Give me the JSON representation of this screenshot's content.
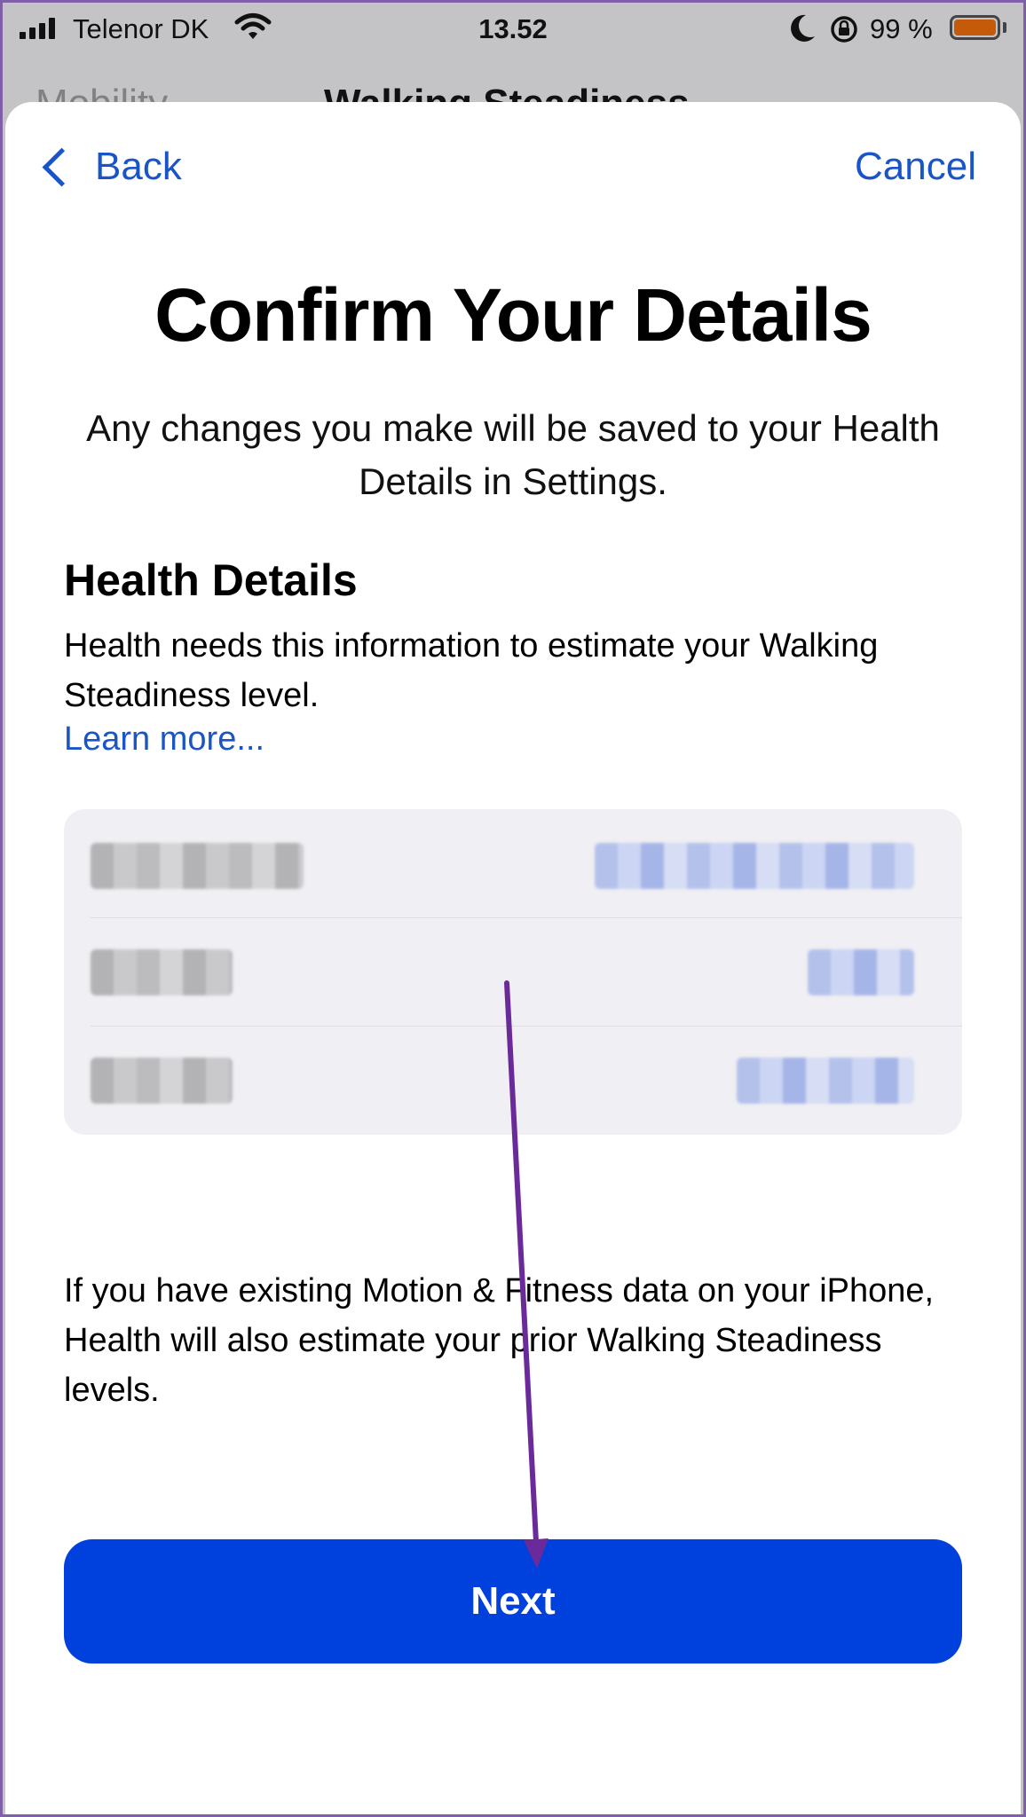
{
  "status_bar": {
    "carrier": "Telenor DK",
    "time": "13.52",
    "battery_percent": "99 %",
    "battery_color": "#c45a0a"
  },
  "behind_nav": {
    "back_label": "Mobility",
    "title": "Walking Steadiness"
  },
  "nav": {
    "back_label": "Back",
    "cancel_label": "Cancel"
  },
  "title": "Confirm Your Details",
  "subtitle": "Any changes you make will be saved to your Health Details in Settings.",
  "section": {
    "heading": "Health Details",
    "description": "Health needs this information to estimate your Walking Steadiness level.",
    "learn_more": "Learn more..."
  },
  "details_rows_note": "values obscured (pixelated)",
  "footnote": "If you have existing Motion & Fitness data on your iPhone, Health will also estimate your prior Walking Steadiness levels.",
  "next_button": {
    "label": "Next"
  },
  "colors": {
    "accent": "#1a55c8",
    "button": "#0040dd",
    "annotation_arrow": "#6b2a9a"
  }
}
